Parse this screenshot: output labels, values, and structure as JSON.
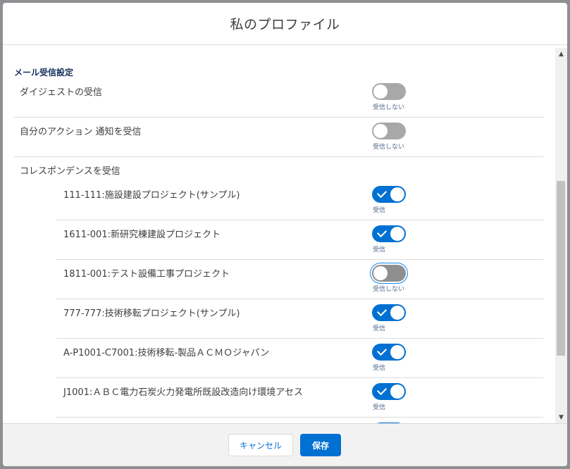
{
  "modal": {
    "title": "私のプロファイル"
  },
  "section": {
    "title": "メール受信設定"
  },
  "settings": [
    {
      "label": "ダイジェストの受信",
      "on": false,
      "status": "受信しない"
    },
    {
      "label": "自分のアクション 通知を受信",
      "on": false,
      "status": "受信しない"
    }
  ],
  "correspondence": {
    "label": "コレスポンデンスを受信"
  },
  "projects": [
    {
      "label": "111-111:施設建設プロジェクト(サンプル)",
      "on": true,
      "status": "受信"
    },
    {
      "label": "1611-001:新研究棟建設プロジェクト",
      "on": true,
      "status": "受信"
    },
    {
      "label": "1811-001:テスト設備工事プロジェクト",
      "on": false,
      "status": "受信しない",
      "focused": true
    },
    {
      "label": "777-777:技術移転プロジェクト(サンプル)",
      "on": true,
      "status": "受信"
    },
    {
      "label": "A-P1001-C7001:技術移転-製品ＡＣＭＯジャパン",
      "on": true,
      "status": "受信"
    },
    {
      "label": "J1001:ＡＢＣ電力石炭火力発電所既設改造向け環境アセス",
      "on": true,
      "status": "受信"
    },
    {
      "label": "",
      "on": true,
      "status": ""
    }
  ],
  "footer": {
    "cancel_label": "キャンセル",
    "save_label": "保存"
  },
  "colors": {
    "accent": "#0070d2",
    "toggle_off": "#a8a8a8",
    "title_text": "#16325c"
  }
}
